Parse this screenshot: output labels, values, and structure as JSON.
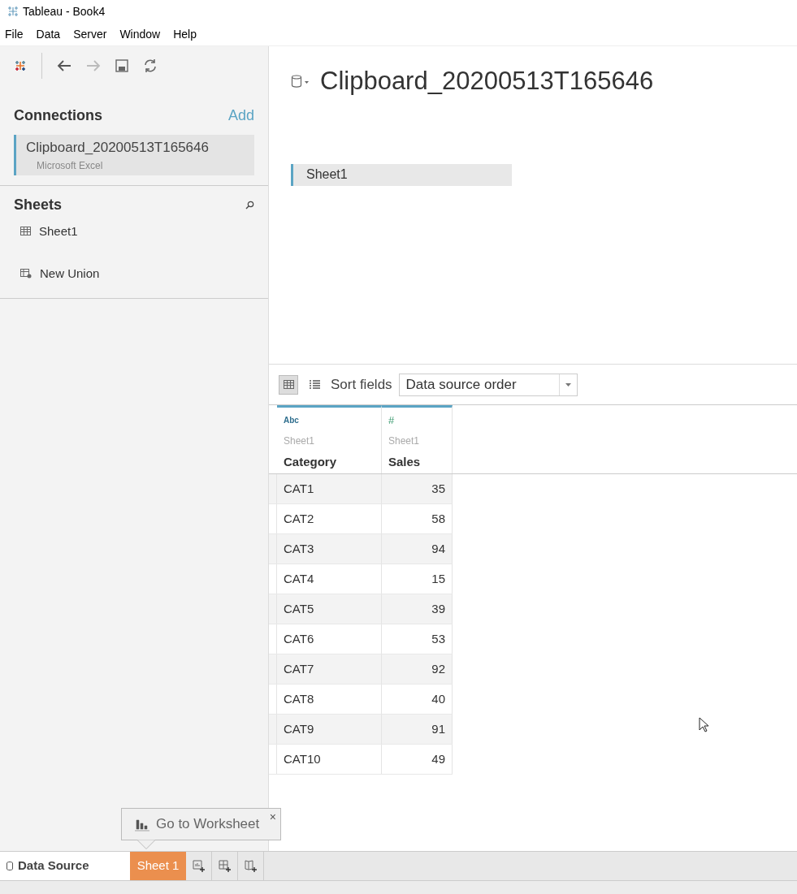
{
  "window": {
    "title": "Tableau - Book4"
  },
  "menu": [
    "File",
    "Data",
    "Server",
    "Window",
    "Help"
  ],
  "connections": {
    "title": "Connections",
    "add": "Add",
    "items": [
      {
        "name": "Clipboard_20200513T165646",
        "type": "Microsoft Excel",
        "selected": true
      }
    ]
  },
  "sheets": {
    "title": "Sheets",
    "items": [
      {
        "kind": "sheet",
        "label": "Sheet1"
      },
      {
        "kind": "union",
        "label": "New Union"
      }
    ]
  },
  "canvas": {
    "title": "Clipboard_20200513T165646",
    "tables": [
      "Sheet1"
    ]
  },
  "grid_toolbar": {
    "views": [
      {
        "kind": "grid",
        "selected": true
      },
      {
        "kind": "list",
        "selected": false
      }
    ],
    "sort_label": "Sort fields",
    "sort_value": "Data source order"
  },
  "table": {
    "columns": [
      {
        "type": "Abc",
        "kind": "string",
        "source": "Sheet1",
        "name": "Category"
      },
      {
        "type": "#",
        "kind": "number",
        "source": "Sheet1",
        "name": "Sales"
      }
    ],
    "rows": [
      [
        "CAT1",
        "35"
      ],
      [
        "CAT2",
        "58"
      ],
      [
        "CAT3",
        "94"
      ],
      [
        "CAT4",
        "15"
      ],
      [
        "CAT5",
        "39"
      ],
      [
        "CAT6",
        "53"
      ],
      [
        "CAT7",
        "92"
      ],
      [
        "CAT8",
        "40"
      ],
      [
        "CAT9",
        "91"
      ],
      [
        "CAT10",
        "49"
      ]
    ]
  },
  "tooltip": {
    "text": "Go to Worksheet",
    "close": "×"
  },
  "tabs": [
    {
      "kind": "data_source",
      "label": "Data Source",
      "selected": true
    },
    {
      "kind": "sheet",
      "label": "Sheet 1",
      "selected": false
    }
  ]
}
